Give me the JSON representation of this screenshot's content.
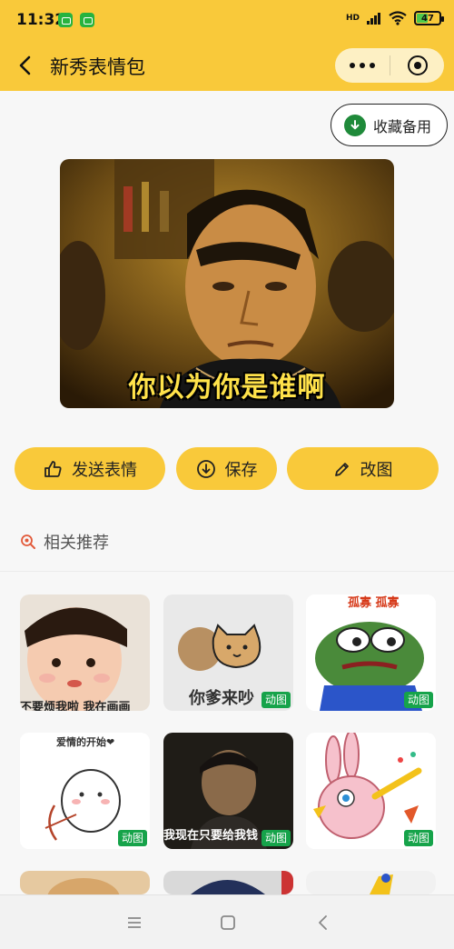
{
  "status_bar": {
    "time": "11:32",
    "network": "HD",
    "battery": "47"
  },
  "header": {
    "title": "新秀表情包"
  },
  "collect_button": {
    "label": "收藏备用"
  },
  "main_sticker": {
    "caption": "你以为你是谁啊"
  },
  "actions": {
    "send_label": "发送表情",
    "save_label": "保存",
    "edit_label": "改图"
  },
  "related": {
    "title": "相关推荐",
    "items": [
      {
        "subject": "child",
        "tag": "",
        "caption": "不要烦我啦 我在画画"
      },
      {
        "subject": "cat",
        "tag": "动图",
        "caption": "你爹来吵"
      },
      {
        "subject": "frog",
        "tag": "动图",
        "caption": "孤寡 孤寡"
      },
      {
        "subject": "cupid",
        "tag": "动图",
        "caption": "爱情的开始❤"
      },
      {
        "subject": "man",
        "tag": "动图",
        "caption": "我现在只要给我钱"
      },
      {
        "subject": "rabbit",
        "tag": "动图",
        "caption": ""
      }
    ]
  },
  "colors": {
    "brand_yellow": "#f9c93a",
    "tag_green": "#16a34a"
  }
}
